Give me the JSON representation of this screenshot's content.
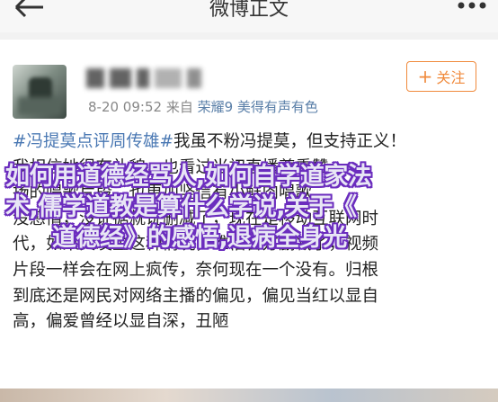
{
  "header": {
    "title": "微博正文",
    "back_icon": "back-arrow-icon",
    "more_icon": "more-dots-icon"
  },
  "post": {
    "meta_time": "8-20 09:52",
    "meta_from": "来自",
    "meta_device": "荣耀9 美得有声有色",
    "follow_label": "关注",
    "follow_icon": "plus-icon",
    "body_lines": [
      {
        "hashtag": "#冯提莫点评周传雄#",
        "text": "我虽不粉冯提莫，但支持正义！"
      },
      {
        "hashtag": "",
        "text": "我相信她很有礼貌，也看过当初直播尊重赞"
      },
      {
        "hashtag": "",
        "text": "扬的唱歌片段，也更加坚信有小鲜肉唱歌"
      },
      {
        "hashtag": "",
        "text": "没感情，没证据就说删减了，现在是移动互联网时"
      },
      {
        "hashtag": "",
        "text": "代，如果真发生这种情况，难怕官方删减了，视频"
      },
      {
        "hashtag": "",
        "text": "片段一样会在网上疯传，奈何现在一个没有。归根"
      },
      {
        "hashtag": "",
        "text": "到底还是网民对网络主播的偏见，偏见当红以显自"
      },
      {
        "hashtag": "",
        "text": "高，偏爱曾经以显自深，丑陋"
      }
    ]
  },
  "overlay": {
    "line1": "如何用道德经骂人,如何自学道家法",
    "line2": "术,儒学道教是算什么学说,关于《",
    "line3": "道德经》的感悟,退病全身光"
  },
  "colors": {
    "accent_orange": "#f08a3c",
    "link_blue": "#4a78b3",
    "overlay_stroke": "#6b2dbe"
  }
}
